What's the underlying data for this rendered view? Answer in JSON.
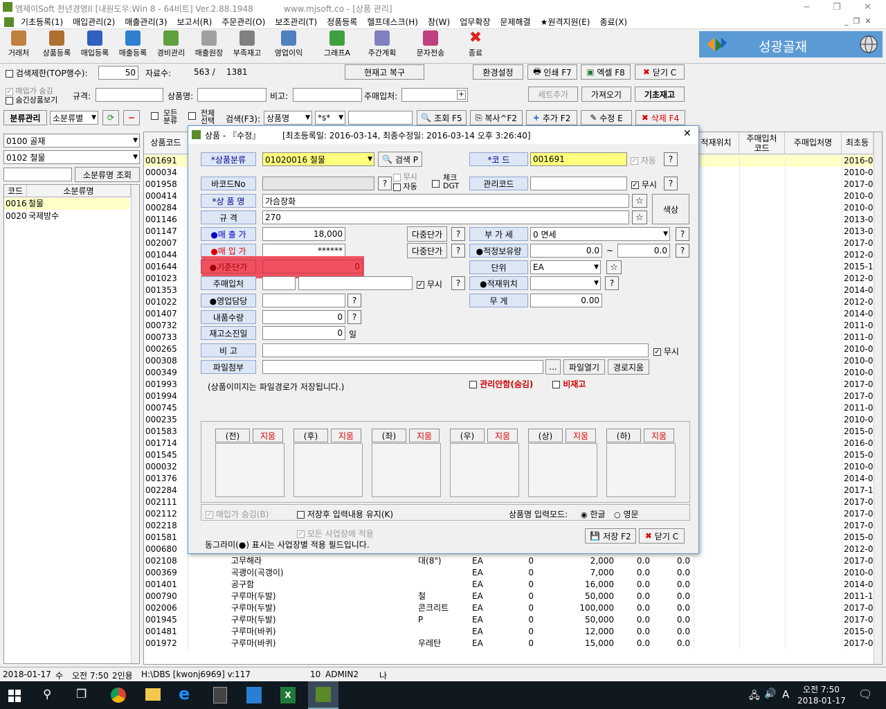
{
  "window": {
    "title": "엠제이Soft 천년경영II [내원도우:Win 8 - 64비트] Ver.2.88.1948",
    "site": "www.mjsoft.co - [상품 관리]",
    "controls": [
      "−",
      "❐",
      "✕"
    ]
  },
  "menu": [
    "기초등록(1)",
    "매입관리(2)",
    "매출관리(3)",
    "보고서(R)",
    "주문관리(O)",
    "보조관리(T)",
    "정품등록",
    "헬프데스크(H)",
    "창(W)",
    "업무확장",
    "문제해결",
    "★원격지원(E)",
    "종료(X)"
  ],
  "toolbar": {
    "items": [
      "거래처",
      "상품등록",
      "매입등록",
      "매출등록",
      "경비관리",
      "매출원장",
      "부족재고",
      "영업이익",
      "그래프A",
      "주간계획",
      "문자전송",
      "종료"
    ],
    "brand": "성광골재"
  },
  "search_row": {
    "limit_label": "검색제한(TOP행수):",
    "limit_value": "50",
    "count_label": "자료수:",
    "count_value": "563 /",
    "count_total": "1381",
    "restore": "현재고 복구",
    "env": "환경설정",
    "print": "인쇄 F7",
    "excel": "엑셀 F8",
    "close": "닫기 C"
  },
  "filter_row": {
    "purchase_hide": "매입가 숨김",
    "hidden_view": "숨긴상품보기",
    "spec_label": "규격:",
    "name_label": "상품명:",
    "note_label": "비고:",
    "supplier_label": "주매입처:",
    "set_add": "세트추가",
    "fetch": "가져오기",
    "base_stock": "기초재고"
  },
  "action_row": {
    "class_mgmt": "분류관리",
    "class_select": "소분류별",
    "all_class": "모든\n분류",
    "all_select": "전체\n선택",
    "search_label": "검색(F3):",
    "search_field": "상품명",
    "search_op": "*s*",
    "query": "조회 F5",
    "copy": "복사^F2",
    "add": "추가 F2",
    "edit": "수정 E",
    "delete": "삭제 F4"
  },
  "left_panel": {
    "cat1": "0100 골재",
    "cat2": "0102 철물",
    "search_btn": "소분류명 조회",
    "headers": [
      "코드",
      "소분류명"
    ],
    "rows": [
      [
        "0016",
        "철물"
      ],
      [
        "0020",
        "국제방수"
      ]
    ]
  },
  "grid": {
    "headers": [
      "상품코드",
      "적재위치",
      "주매입처\n코드",
      "주매입처명",
      "최초등"
    ],
    "codes": [
      "001691",
      "000034",
      "001958",
      "000414",
      "000284",
      "001146",
      "001147",
      "002007",
      "001044",
      "001644",
      "001023",
      "001353",
      "001022",
      "001407",
      "000732",
      "000733",
      "000265",
      "000308",
      "000349",
      "001993",
      "001994",
      "000745",
      "000235",
      "001583",
      "001714",
      "001545",
      "000032",
      "001376",
      "002284",
      "002111",
      "002112",
      "002218",
      "001581",
      "000680",
      "002108",
      "000369",
      "001401",
      "000790",
      "002006",
      "001945",
      "001481",
      "001972"
    ],
    "dates": [
      "2016-0",
      "2010-0",
      "2017-0",
      "2010-0",
      "2010-0",
      "2013-0",
      "2013-0",
      "2017-0",
      "2012-0",
      "2015-1",
      "2012-0",
      "2014-0",
      "2012-0",
      "2014-0",
      "2011-0",
      "2011-0",
      "2010-0",
      "2010-0",
      "2010-0",
      "2017-0",
      "2017-0",
      "2011-0",
      "2010-0",
      "2015-0",
      "2016-0",
      "2015-0",
      "2010-0",
      "2014-0",
      "2017-1",
      "2017-0",
      "2017-0",
      "2017-0",
      "2015-0",
      "2012-0",
      "2017-0",
      "2010-0",
      "2014-0",
      "2011-1",
      "2017-0",
      "2017-0",
      "2015-0",
      "2017-0"
    ],
    "tail_rows": [
      {
        "code": "002108",
        "name": "고무해라",
        "spec": "대(8\")",
        "unit": "EA",
        "qty": "0",
        "price": "2,000",
        "a": "0.0",
        "b": "0.0"
      },
      {
        "code": "000369",
        "name": "곡괭이(곡갱이)",
        "spec": "",
        "unit": "EA",
        "qty": "0",
        "price": "7,000",
        "a": "0.0",
        "b": "0.0"
      },
      {
        "code": "001401",
        "name": "공구함",
        "spec": "",
        "unit": "EA",
        "qty": "0",
        "price": "16,000",
        "a": "0.0",
        "b": "0.0"
      },
      {
        "code": "000790",
        "name": "구루마(두발)",
        "spec": "철",
        "unit": "EA",
        "qty": "0",
        "price": "50,000",
        "a": "0.0",
        "b": "0.0"
      },
      {
        "code": "002006",
        "name": "구루마(두발)",
        "spec": "콘크리트",
        "unit": "EA",
        "qty": "0",
        "price": "100,000",
        "a": "0.0",
        "b": "0.0"
      },
      {
        "code": "001945",
        "name": "구루마(두발)",
        "spec": "P",
        "unit": "EA",
        "qty": "0",
        "price": "50,000",
        "a": "0.0",
        "b": "0.0"
      },
      {
        "code": "001481",
        "name": "구루마(바퀴)",
        "spec": "",
        "unit": "EA",
        "qty": "0",
        "price": "12,000",
        "a": "0.0",
        "b": "0.0"
      },
      {
        "code": "001972",
        "name": "구루마(바퀴)",
        "spec": "우레탄",
        "unit": "EA",
        "qty": "0",
        "price": "15,000",
        "a": "0.0",
        "b": "0.0"
      }
    ]
  },
  "dialog": {
    "title": "상품 - 『수정』",
    "dates": "[최초등록일: 2016-03-14, 최종수정일: 2016-03-14 오후 3:26:40]",
    "labels": {
      "category": "*상품분류",
      "code": "*코  드",
      "barcode": "바코드No",
      "mgmt_code": "관리코드",
      "name": "*상 품 명",
      "spec": "규  격",
      "sale": "●매 출 가",
      "vat": "부 가 세",
      "purchase": "●매 입 가",
      "stock_proper": "●적정보유량",
      "base_price": "●기준단가",
      "unit": "단위",
      "supplier": "주매입처",
      "location": "●적재위치",
      "sales_rep": "●영업담당",
      "weight": "무  게",
      "delivery_qty": "내품수량",
      "stock_days": "재고소진일",
      "note": "비  고",
      "file": "파일첨부"
    },
    "values": {
      "category": "01020016 철물",
      "code": "001691",
      "name": "가슴장화",
      "spec": "270",
      "sale": "18,000",
      "purchase": "******",
      "base_price": "0",
      "vat": "0 면세",
      "stock_min": "0.0",
      "stock_max": "0.0",
      "unit": "EA",
      "weight": "0.00",
      "delivery_qty": "0",
      "stock_days": "0"
    },
    "buttons": {
      "search": "검색 P",
      "multi_price": "다중단가",
      "color": "색상",
      "open_file": "파일열기",
      "clear_path": "경로지움",
      "browse": "...",
      "save": "저장 F2",
      "close": "닫기 C"
    },
    "text": {
      "auto": "자동",
      "no_check": "무시",
      "check_dgt": "체크\nDGT",
      "no_use": "무시",
      "auto2": "자동",
      "day": "일",
      "image_note": "(상품이미지는 파일경로가 저장됩니다.)",
      "hide_mgmt": "관리안함(숨김)",
      "non_stock": "비재고",
      "tilde": "~"
    },
    "image_slots": [
      {
        "label": "(전)",
        "del": "지움"
      },
      {
        "label": "(후)",
        "del": "지움"
      },
      {
        "label": "(좌)",
        "del": "지움"
      },
      {
        "label": "(우)",
        "del": "지움"
      },
      {
        "label": "(상)",
        "del": "지움"
      },
      {
        "label": "(하)",
        "del": "지움"
      }
    ],
    "bottom": {
      "purchase_hide": "매입가 숨김(B)",
      "keep_input": "저장후 입력내용 유지(K)",
      "input_mode": "상품명 입력모드:",
      "korean": "한글",
      "english": "영문",
      "all_sites": "모든 사업장에 적용",
      "footnote": "동그라미(●) 표시는 사업장별 적용 필드입니다."
    }
  },
  "statusbar": {
    "date": "2018-01-17",
    "weekday": "수",
    "time": "오전 7:50",
    "users": "2인용",
    "path": "H:\\DBS [kwonj6969] v:117",
    "num": "10",
    "user": "ADMIN2",
    "me": "나"
  },
  "taskbar": {
    "time": "오전 7:50",
    "date": "2018-01-17",
    "ime": "A"
  },
  "colors": {
    "accent": "#0078d7",
    "required_field": "#ffff80",
    "highlight_red": "#f05060",
    "brand_bg": "#5b9bd5"
  }
}
